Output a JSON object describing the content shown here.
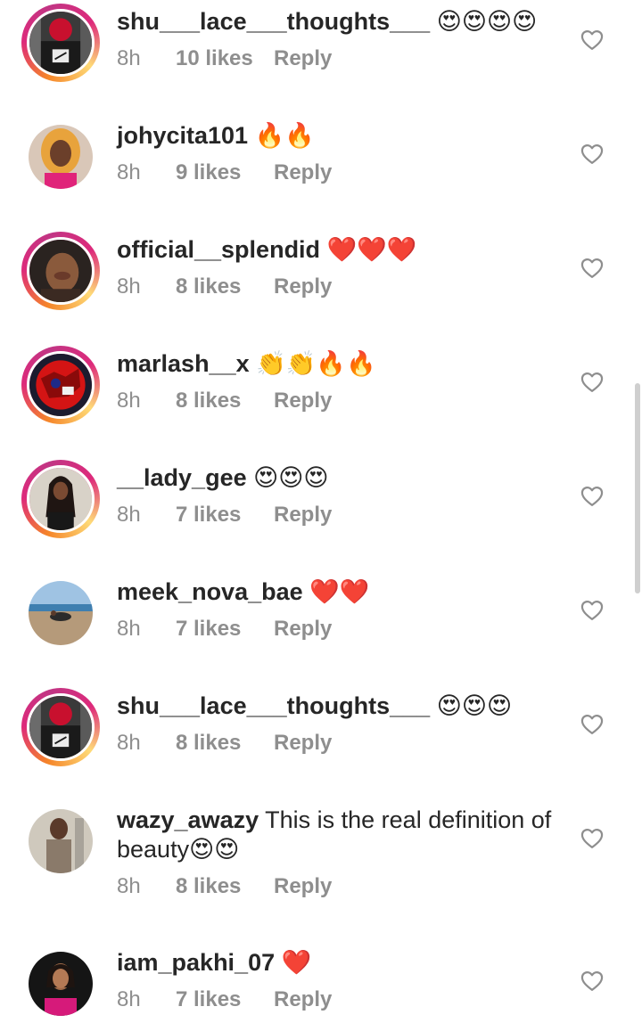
{
  "comments": [
    {
      "username": "shu___lace___thoughts___",
      "text": "😍😍😍😍",
      "time": "8h",
      "likes": "10 likes",
      "reply": "Reply",
      "avatar_ring": true,
      "avatar_desc": "hooded-figure-avatar"
    },
    {
      "username": "johycita101",
      "text": "🔥🔥",
      "time": "8h",
      "likes": "9 likes",
      "reply": "Reply",
      "avatar_ring": false,
      "avatar_desc": "woman-portrait-avatar"
    },
    {
      "username": "official__splendid",
      "text": "❤️❤️❤️",
      "time": "8h",
      "likes": "8 likes",
      "reply": "Reply",
      "avatar_ring": true,
      "avatar_desc": "woman-portrait-avatar"
    },
    {
      "username": "marlash__x",
      "text": "👏👏🔥🔥",
      "time": "8h",
      "likes": "8 likes",
      "reply": "Reply",
      "avatar_ring": true,
      "avatar_desc": "red-graphic-avatar"
    },
    {
      "username": "__lady_gee",
      "text": "😍😍😍",
      "time": "8h",
      "likes": "7 likes",
      "reply": "Reply",
      "avatar_ring": true,
      "avatar_desc": "woman-portrait-avatar"
    },
    {
      "username": "meek_nova_bae",
      "text": "❤️❤️",
      "time": "8h",
      "likes": "7 likes",
      "reply": "Reply",
      "avatar_ring": false,
      "avatar_desc": "beach-photo-avatar"
    },
    {
      "username": "shu___lace___thoughts___",
      "text": "😍😍😍",
      "time": "8h",
      "likes": "8 likes",
      "reply": "Reply",
      "avatar_ring": true,
      "avatar_desc": "hooded-figure-avatar"
    },
    {
      "username": "wazy_awazy",
      "text": "This is the real definition of beauty😍😍",
      "time": "8h",
      "likes": "8 likes",
      "reply": "Reply",
      "avatar_ring": false,
      "avatar_desc": "man-portrait-avatar"
    },
    {
      "username": "iam_pakhi_07",
      "text": "❤️",
      "time": "8h",
      "likes": "7 likes",
      "reply": "Reply",
      "avatar_ring": false,
      "avatar_desc": "woman-portrait-avatar"
    }
  ],
  "colors": {
    "text": "#262626",
    "meta": "#8e8e8e",
    "heart_outline": "#8e8e8e",
    "background": "#ffffff"
  }
}
